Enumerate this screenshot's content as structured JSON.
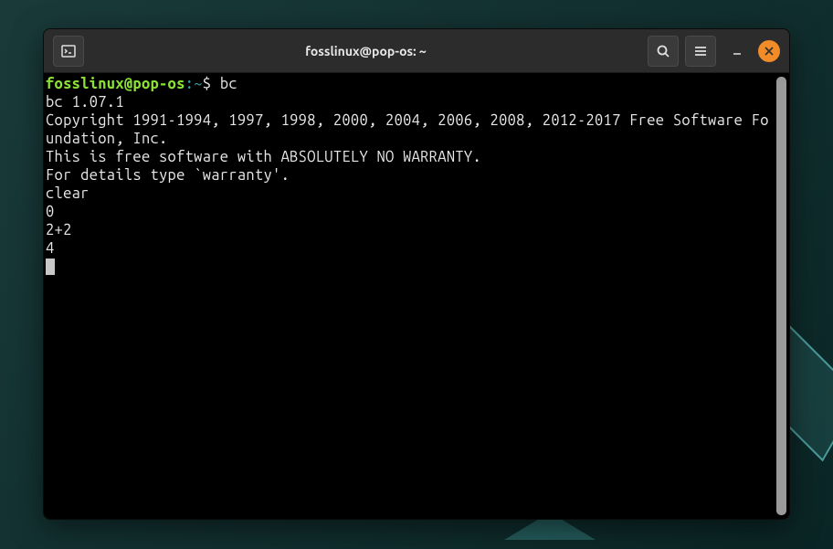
{
  "titlebar": {
    "title": "fosslinux@pop-os: ~"
  },
  "prompt": {
    "user_host": "fosslinux@pop-os",
    "separator": ":",
    "path": "~",
    "symbol": "$ ",
    "command": "bc"
  },
  "output": {
    "version": "bc 1.07.1",
    "copyright": "Copyright 1991-1994, 1997, 1998, 2000, 2004, 2006, 2008, 2012-2017 Free Software Foundation, Inc.",
    "notice": "This is free software with ABSOLUTELY NO WARRANTY.",
    "details": "For details type `warranty'.",
    "lines": [
      "clear",
      "0",
      "2+2",
      "4"
    ]
  }
}
